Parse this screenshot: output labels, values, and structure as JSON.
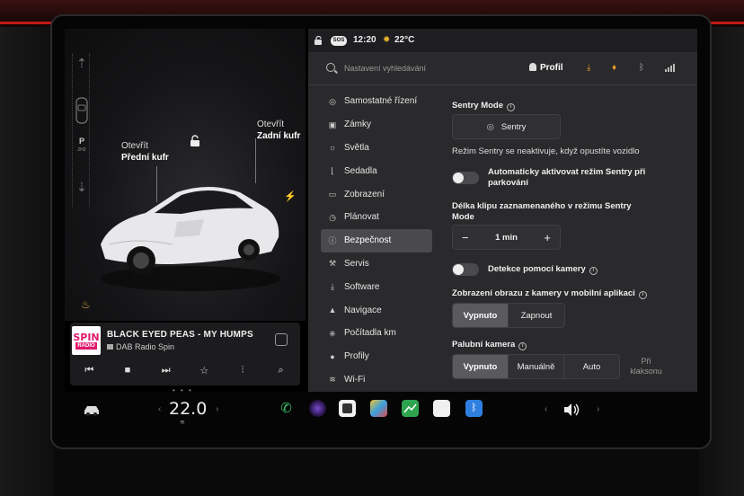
{
  "gear": {
    "current": "P",
    "sub": "2H2"
  },
  "trunks": {
    "front": {
      "action": "Otevřít",
      "name": "Přední kufr"
    },
    "rear": {
      "action": "Otevřít",
      "name": "Zadní kufr"
    }
  },
  "media": {
    "album_line1": "SPIN",
    "album_line2": "RADIO",
    "title": "BLACK EYED PEAS - MY HUMPS",
    "station": "DAB Radio Spin"
  },
  "status_bar": {
    "sos": "SOS",
    "time": "12:20",
    "temperature": "22°C"
  },
  "search": {
    "placeholder": "Nastavení vyhledávání"
  },
  "profile": {
    "label": "Profil"
  },
  "nav": {
    "items": [
      {
        "label": "Samostatné řízení",
        "icon": "steering-wheel-icon"
      },
      {
        "label": "Zámky",
        "icon": "lock-icon"
      },
      {
        "label": "Světla",
        "icon": "light-icon"
      },
      {
        "label": "Sedadla",
        "icon": "seat-icon"
      },
      {
        "label": "Zobrazení",
        "icon": "display-icon"
      },
      {
        "label": "Plánovat",
        "icon": "clock-icon"
      },
      {
        "label": "Bezpečnost",
        "icon": "info-circle-icon",
        "active": true
      },
      {
        "label": "Servis",
        "icon": "wrench-icon"
      },
      {
        "label": "Software",
        "icon": "download-icon"
      },
      {
        "label": "Navigace",
        "icon": "navigation-icon"
      },
      {
        "label": "Počítadla km",
        "icon": "trip-icon"
      },
      {
        "label": "Profily",
        "icon": "person-icon"
      },
      {
        "label": "Wi-Fi",
        "icon": "wifi-icon"
      }
    ]
  },
  "security": {
    "sentry_heading": "Sentry Mode",
    "sentry_button": "Sentry",
    "sentry_note": "Režim Sentry se neaktivuje, když opustíte vozidlo",
    "auto_sentry_label": "Automaticky aktivovat režim Sentry při parkování",
    "auto_sentry_on": false,
    "clip_heading": "Délka klipu zaznamenaného v režimu Sentry Mode",
    "clip_minus": "−",
    "clip_value": "1 min",
    "clip_plus": "+",
    "camera_detect_label": "Detekce pomocí kamery",
    "camera_detect_on": false,
    "mobile_view_heading": "Zobrazení obrazu z kamery v mobilní aplikaci",
    "mobile_view_options": [
      "Vypnuto",
      "Zapnout"
    ],
    "mobile_view_selected": "Vypnuto",
    "dashcam_heading": "Palubní kamera",
    "dashcam_options": [
      "Vypnuto",
      "Manuálně",
      "Auto"
    ],
    "dashcam_selected": "Vypnuto",
    "dashcam_extra": "Při klaksonu"
  },
  "dock": {
    "temperature": "22.0",
    "left_arrow": "‹",
    "right_arrow": "›",
    "vol_left": "‹",
    "vol_right": "›"
  },
  "colors": {
    "accent_red": "#c21818",
    "download_orange": "#e39b2b",
    "alert_orange": "#e39b2b",
    "panel_bg": "#2a2a2c",
    "selected_segment": "#5a5a5e",
    "spin_pink": "#e0186c"
  }
}
